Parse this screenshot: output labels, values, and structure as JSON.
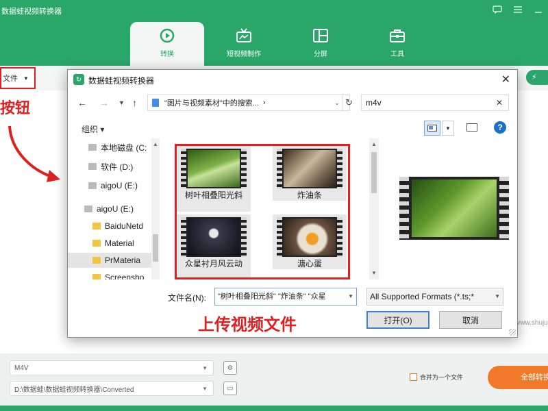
{
  "app": {
    "title": "数据蛙视频转换器",
    "tabs": [
      {
        "label": "转换",
        "icon": "convert-icon"
      },
      {
        "label": "短视频制作",
        "icon": "tv-icon"
      },
      {
        "label": "分屏",
        "icon": "split-screen-icon"
      },
      {
        "label": "工具",
        "icon": "toolbox-icon"
      }
    ],
    "active_tab": "转换",
    "add_file_label": "文件",
    "start_label": "⚡",
    "annotation_button": "按钮",
    "watermark": "www.shuju"
  },
  "dialog": {
    "title": "数据蛙视频转换器",
    "address": "\"图片与视频素材\"中的搜索...",
    "address_sep": "›",
    "search_value": "m4v",
    "organize_label": "组织 ▾",
    "tree": [
      {
        "label": "本地磁盘 (C:",
        "type": "drive"
      },
      {
        "label": "软件 (D:)",
        "type": "drive"
      },
      {
        "label": "aigoU (E:)",
        "type": "drive"
      },
      {
        "label": "aigoU (E:)",
        "type": "drive"
      },
      {
        "label": "BaiduNetd",
        "type": "folder"
      },
      {
        "label": "Material",
        "type": "folder"
      },
      {
        "label": "PrMateria",
        "type": "folder"
      },
      {
        "label": "Screensho",
        "type": "folder"
      }
    ],
    "files": [
      {
        "name": "树叶相叠阳光斜",
        "selected": true
      },
      {
        "name": "炸油条",
        "selected": true
      },
      {
        "name": "众星衬月风云动",
        "selected": true
      },
      {
        "name": "溏心蛋",
        "selected": true
      }
    ],
    "filename_label": "文件名(N):",
    "filename_value": "\"树叶相叠阳光斜\" \"炸油条\" \"众星",
    "format_value": "All Supported Formats (*.ts;*",
    "open_label": "打开(O)",
    "cancel_label": "取消",
    "annotation_upload": "上传视频文件"
  },
  "bottom": {
    "format_value": "M4V",
    "output_path": "D:\\数据蛙\\数据蛙视频转换器\\Converted",
    "merge_label": "合并为一个文件",
    "convert_all_label": "全部转换"
  },
  "colors": {
    "brand_green": "#2aa66b",
    "annotation_red": "#e02020",
    "convert_orange": "#f07a2a"
  }
}
